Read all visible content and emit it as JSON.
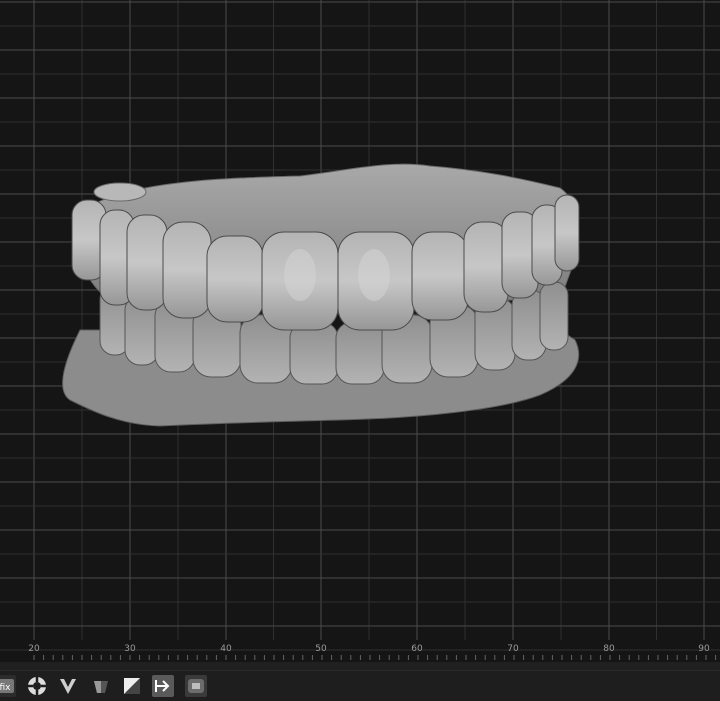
{
  "viewport": {
    "ruler_labels": [
      "20",
      "30",
      "40",
      "50",
      "60",
      "70",
      "80",
      "90"
    ],
    "model": "dental-arch-scan"
  },
  "toolbar": {
    "buttons": [
      {
        "name": "fix-tool-button",
        "icon": "fix-icon",
        "label": "fix"
      },
      {
        "name": "lifebuoy-tool-button",
        "icon": "lifebuoy-icon"
      },
      {
        "name": "v-tool-button",
        "icon": "v-cut-icon"
      },
      {
        "name": "shade-tool-button",
        "icon": "shaded-sphere-icon"
      },
      {
        "name": "square-tool-button",
        "icon": "half-square-icon"
      },
      {
        "name": "arrow-tool-button",
        "icon": "arrow-right-icon"
      },
      {
        "name": "cube-tool-button",
        "icon": "cube-icon",
        "label": "cube"
      }
    ]
  },
  "colors": {
    "background": "#151515",
    "grid": "#4a4a4a",
    "model": "#9c9c9c",
    "active_tool": "#5a5a5a"
  }
}
